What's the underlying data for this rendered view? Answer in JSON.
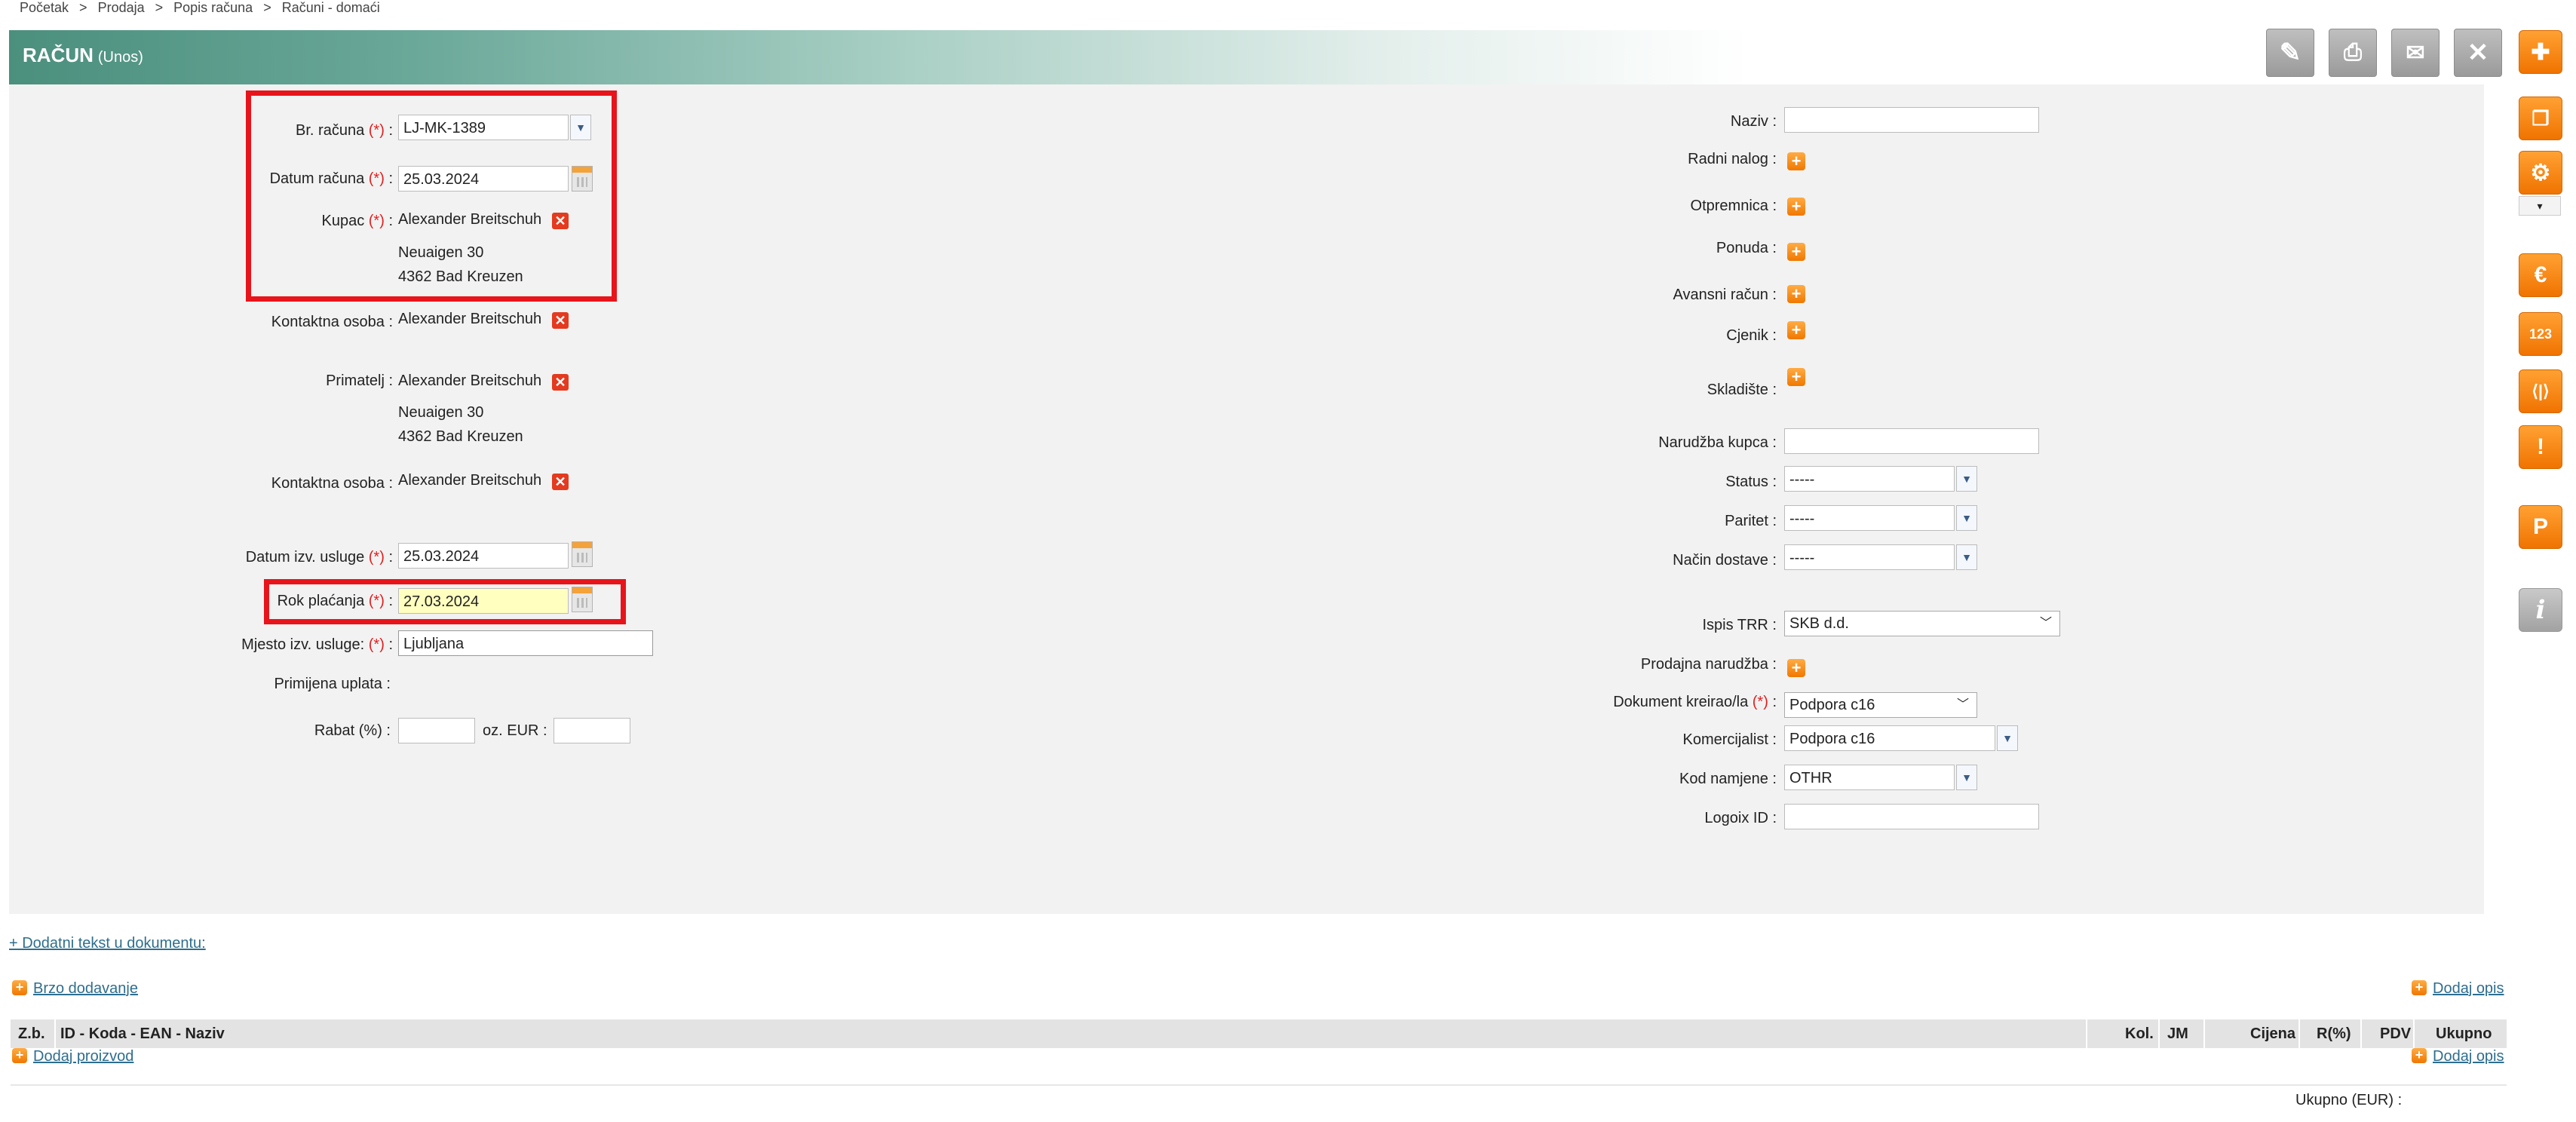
{
  "breadcrumb": [
    "Početak",
    "Prodaja",
    "Popis računa",
    "Računi - domaći"
  ],
  "breadcrumb_sep": ">",
  "header": {
    "title": "RAČUN",
    "subtitle": "(Unos)"
  },
  "left": {
    "br_racuna": {
      "label": "Br. računa",
      "req": "(*)",
      "value": "LJ-MK-1389"
    },
    "datum_racuna": {
      "label": "Datum računa",
      "req": "(*)",
      "value": "25.03.2024"
    },
    "kupac": {
      "label": "Kupac",
      "req": "(*)",
      "name": "Alexander Breitschuh",
      "street": "Neuaigen 30",
      "city": "4362 Bad Kreuzen"
    },
    "kontakt1": {
      "label": "Kontaktna osoba :",
      "value": "Alexander Breitschuh"
    },
    "primatelj": {
      "label": "Primatelj :",
      "name": "Alexander Breitschuh",
      "street": "Neuaigen 30",
      "city": "4362 Bad Kreuzen"
    },
    "kontakt2": {
      "label": "Kontaktna osoba :",
      "value": "Alexander Breitschuh"
    },
    "datum_usluge": {
      "label": "Datum izv. usluge",
      "req": "(*)",
      "value": "25.03.2024"
    },
    "rok_placanja": {
      "label": "Rok plaćanja",
      "req": "(*)",
      "value": "27.03.2024"
    },
    "mjesto": {
      "label": "Mjesto izv. usluge:",
      "req": "(*)",
      "value": "Ljubljana"
    },
    "uplata": {
      "label": "Primijena uplata :"
    },
    "rabat": {
      "label": "Rabat (%) :",
      "eur_label": "oz. EUR :",
      "value": "",
      "eur_value": ""
    },
    "colon": ":"
  },
  "right": {
    "naziv": {
      "label": "Naziv :",
      "value": ""
    },
    "radni_nalog": "Radni nalog :",
    "otpremnica": "Otpremnica :",
    "ponuda": "Ponuda :",
    "avansni": "Avansni račun :",
    "cjenik": "Cjenik :",
    "skladiste": "Skladište :",
    "narudzba": {
      "label": "Narudžba kupca :",
      "value": ""
    },
    "status": {
      "label": "Status :",
      "value": "-----"
    },
    "paritet": {
      "label": "Paritet :",
      "value": "-----"
    },
    "nacin": {
      "label": "Način dostave :",
      "value": "-----"
    },
    "ispis_trr": {
      "label": "Ispis TRR :",
      "value": "SKB d.d."
    },
    "prodajna": "Prodajna narudžba :",
    "dokument": {
      "label": "Dokument kreirao/la",
      "req": "(*)",
      "value": "Podpora c16"
    },
    "komercijalist": {
      "label": "Komercijalist :",
      "value": "Podpora c16"
    },
    "kod_namjene": {
      "label": "Kod namjene :",
      "value": "OTHR"
    },
    "logoix": {
      "label": "Logoix ID :",
      "value": ""
    }
  },
  "bottom": {
    "dodatni_tekst": "+ Dodatni tekst u dokumentu:",
    "brzo_dodavanje": "Brzo dodavanje",
    "dodaj_opis": "Dodaj opis",
    "dodaj_proizvod": "Dodaj proizvod",
    "dodaj_opis2": "Dodaj opis",
    "columns": [
      "Z.b.",
      "ID - Koda - EAN - Naziv",
      "Kol.",
      "JM",
      "Cijena",
      "R(%)",
      "PDV",
      "Ukupno"
    ],
    "ukupno_label": "Ukupno (EUR) :"
  },
  "toolbar_icons": [
    "pencil-icon",
    "printer-icon",
    "envelope-icon",
    "close-icon",
    "plus-icon",
    "copy-icon",
    "gear-icon",
    "euro-icon",
    "numbers-icon",
    "split-icon",
    "warning-icon",
    "p-icon",
    "info-icon"
  ],
  "colors": {
    "header": "#4b8f7d",
    "accent": "#f07300",
    "required": "#e02020",
    "highlight_box": "#e8141b"
  }
}
